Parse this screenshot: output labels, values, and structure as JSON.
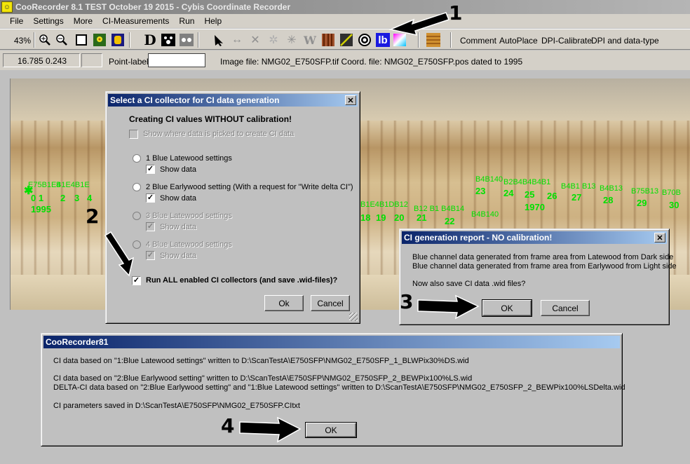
{
  "window": {
    "title": "CooRecorder 8.1  TEST October 19 2015  -  Cybis Coordinate Recorder",
    "app_icon": "smiley-icon"
  },
  "menu": [
    "File",
    "Settings",
    "More",
    "CI-Measurements",
    "Run",
    "Help"
  ],
  "toolbar": {
    "zoom": "43%",
    "text_buttons": [
      "Comment",
      "AutoPlace",
      "DPI-Calibrate",
      "DPI and data-type"
    ],
    "lb_label": "lb",
    "d_label": "D",
    "w_label": "W"
  },
  "statusbar": {
    "coords": "16.785  0.243",
    "point_label_caption": "Point-label:",
    "point_label_value": "",
    "file_info": "Image file: NMG02_E750SFP.tif  Coord. file: NMG02_E750SFP.pos dated to 1995"
  },
  "wood_markers": [
    {
      "label": "0 1",
      "year": "1995"
    },
    {
      "label": "2"
    },
    {
      "label": "3"
    },
    {
      "label": "4"
    },
    {
      "label": "18"
    },
    {
      "label": "19"
    },
    {
      "label": "20"
    },
    {
      "label": "21"
    },
    {
      "label": "22"
    },
    {
      "label": "23"
    },
    {
      "label": "24"
    },
    {
      "label": "25",
      "year": "1970"
    },
    {
      "label": "26"
    },
    {
      "label": "27"
    },
    {
      "label": "28"
    },
    {
      "label": "29"
    },
    {
      "label": "30"
    }
  ],
  "ci_collector_dialog": {
    "title": "Select a CI collector for CI data generation",
    "heading": "Creating CI values WITHOUT calibration!",
    "show_where": "Show where data is picked to create CI data",
    "options": [
      {
        "label": "1 Blue Latewood settings",
        "show": "Show data",
        "enabled": true
      },
      {
        "label": "2 Blue Earlywood setting (With a request for \"Write delta CI\")",
        "show": "Show data",
        "enabled": true
      },
      {
        "label": "3 Blue Latewood settings",
        "show": "Show data",
        "enabled": false
      },
      {
        "label": "4 Blue Latewood settings",
        "show": "Show data",
        "enabled": false
      }
    ],
    "run_all": "Run ALL enabled CI collectors (and save .wid-files)?",
    "ok": "Ok",
    "cancel": "Cancel"
  },
  "report_dialog": {
    "title": "CI generation report - NO calibration!",
    "line1": "Blue channel data generated from frame area from Latewood from Dark side",
    "line2": "Blue channel data generated from frame area from Earlywood from Light side",
    "question": "Now also save CI data .wid files?",
    "ok": "OK",
    "cancel": "Cancel"
  },
  "result_dialog": {
    "title": "CooRecorder81",
    "line1": "CI data based on \"1:Blue Latewood settings\" written to D:\\ScanTestA\\E750SFP\\NMG02_E750SFP_1_BLWPix30%DS.wid",
    "line2": "CI data based on \"2:Blue Earlywood setting\" written to D:\\ScanTestA\\E750SFP\\NMG02_E750SFP_2_BEWPix100%LS.wid",
    "line3": "DELTA-CI data based on \"2:Blue Earlywood setting\" and \"1:Blue Latewood settings\" written to D:\\ScanTestA\\E750SFP\\NMG02_E750SFP_2_BEWPix100%LSDelta.wid",
    "line4": "CI parameters saved in D:\\ScanTestA\\E750SFP\\NMG02_E750SFP.CItxt",
    "ok": "OK"
  },
  "annotations": [
    "1",
    "2",
    "3",
    "4"
  ]
}
